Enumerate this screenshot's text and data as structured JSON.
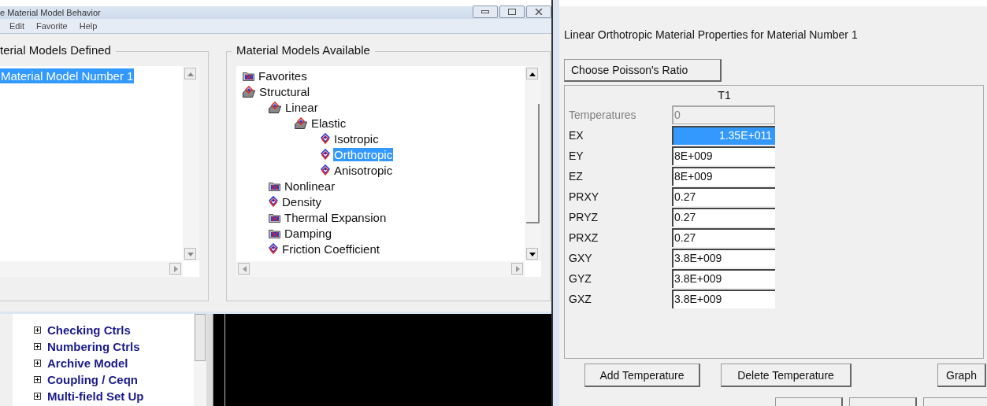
{
  "window": {
    "title": "e Material Model Behavior",
    "menu": [
      "Edit",
      "Favorite",
      "Help"
    ]
  },
  "defined": {
    "title": "terial Models Defined",
    "items": [
      {
        "label": "Material Model Number 1",
        "selected": true
      }
    ]
  },
  "available": {
    "title": "Material Models Available",
    "tree": [
      {
        "label": "Favorites",
        "kind": "folder",
        "selected": false
      },
      {
        "label": "Structural",
        "kind": "open",
        "selected": false,
        "children": [
          {
            "label": "Linear",
            "kind": "open",
            "selected": false,
            "children": [
              {
                "label": "Elastic",
                "kind": "open",
                "selected": false,
                "children": [
                  {
                    "label": "Isotropic",
                    "kind": "leaf",
                    "selected": false
                  },
                  {
                    "label": "Orthotropic",
                    "kind": "leaf",
                    "selected": true
                  },
                  {
                    "label": "Anisotropic",
                    "kind": "leaf",
                    "selected": false
                  }
                ]
              }
            ]
          },
          {
            "label": "Nonlinear",
            "kind": "folder",
            "selected": false
          },
          {
            "label": "Density",
            "kind": "leaf",
            "selected": false
          },
          {
            "label": "Thermal Expansion",
            "kind": "folder",
            "selected": false
          },
          {
            "label": "Damping",
            "kind": "folder",
            "selected": false
          },
          {
            "label": "Friction Coefficient",
            "kind": "leaf",
            "selected": false
          }
        ]
      }
    ]
  },
  "main_tree": {
    "items": [
      "Checking Ctrls",
      "Numbering Ctrls",
      "Archive Model",
      "Coupling / Ceqn",
      "Multi-field Set Up"
    ]
  },
  "dialog": {
    "heading": "Linear Orthotropic Material Properties for Material Number 1",
    "poisson_button": "Choose Poisson's Ratio",
    "column": "T1",
    "rows": [
      {
        "label": "Temperatures",
        "value": "0",
        "disabled": true,
        "selected": false
      },
      {
        "label": "EX",
        "value": "1.35E+011",
        "disabled": false,
        "selected": true
      },
      {
        "label": "EY",
        "value": "8E+009",
        "disabled": false,
        "selected": false
      },
      {
        "label": "EZ",
        "value": "8E+009",
        "disabled": false,
        "selected": false
      },
      {
        "label": "PRXY",
        "value": "0.27",
        "disabled": false,
        "selected": false
      },
      {
        "label": "PRYZ",
        "value": "0.27",
        "disabled": false,
        "selected": false
      },
      {
        "label": "PRXZ",
        "value": "0.27",
        "disabled": false,
        "selected": false
      },
      {
        "label": "GXY",
        "value": "3.8E+009",
        "disabled": false,
        "selected": false
      },
      {
        "label": "GYZ",
        "value": "3.8E+009",
        "disabled": false,
        "selected": false
      },
      {
        "label": "GXZ",
        "value": "3.8E+009",
        "disabled": false,
        "selected": false
      }
    ],
    "table_buttons": [
      "Add Temperature",
      "Delete Temperature",
      "Graph"
    ]
  }
}
